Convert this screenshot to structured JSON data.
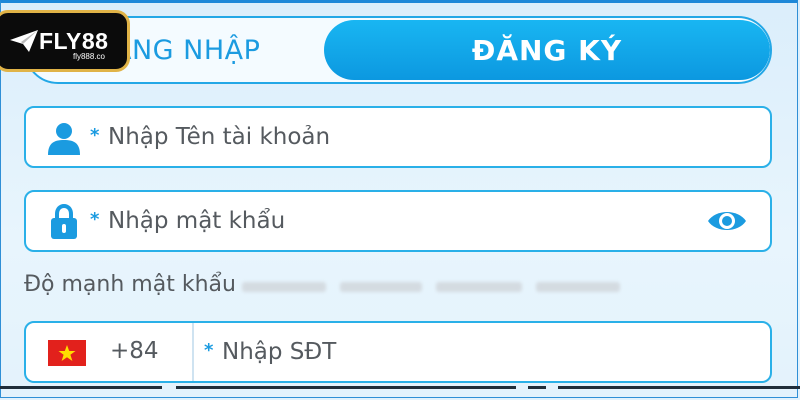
{
  "tabs": {
    "login_label": "ĐĂNG NHẬP",
    "register_label": "ĐĂNG KÝ"
  },
  "logo": {
    "text": "FLY88",
    "sub": "fly888.co"
  },
  "username": {
    "placeholder": "Nhập Tên tài khoản",
    "required_mark": "*"
  },
  "password": {
    "placeholder": "Nhập mật khẩu",
    "required_mark": "*"
  },
  "strength": {
    "label": "Độ mạnh mật khẩu"
  },
  "phone": {
    "country_code": "+84",
    "placeholder": "Nhập SĐT",
    "required_mark": "*"
  },
  "icons": {
    "user": "user-icon",
    "lock": "lock-icon",
    "eye": "eye-icon",
    "flag": "vietnam-flag-icon",
    "plane": "plane-icon"
  },
  "colors": {
    "accent": "#0c98e0",
    "border": "#2ab0e8",
    "text_gray": "#555a5f",
    "logo_gold": "#e0b347",
    "flag_red": "#e2211c",
    "flag_star": "#ffdd00"
  }
}
